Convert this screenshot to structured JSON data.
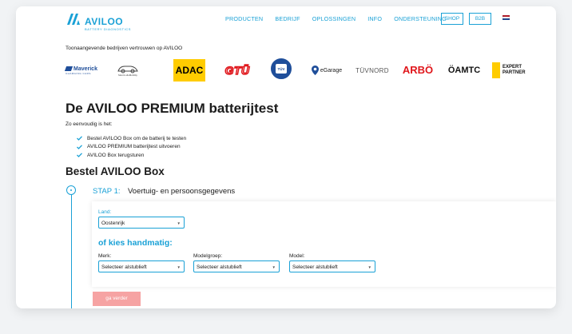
{
  "header": {
    "brand": "AVILOO",
    "brand_sub": "BATTERY DIAGNOSTICS",
    "nav": [
      "PRODUCTEN",
      "BEDRIJF",
      "OPLOSSINGEN",
      "INFO",
      "ONDERSTEUNING"
    ],
    "shop_label": "SHOP",
    "b2b_label": "B2B",
    "flag_colors": [
      "#ae1c28",
      "#ffffff",
      "#21468b"
    ]
  },
  "trusted": {
    "text": "Toonaangevende bedrijven vertrouwen op AVILOO",
    "logos": {
      "maverick": "Maverick",
      "maverick_sub": "CHARGING CARS",
      "mobility_sub": "Merck elloMobility",
      "adac": "ADAC",
      "gtu": "GTÜ",
      "tuv_small": "TÜV",
      "egarage": "eGarage",
      "tuvnord": "TÜVNORD",
      "arbo": "ARBÖ",
      "oamtc": "ÖAMTC",
      "expert": "EXPERT PARTNER"
    }
  },
  "main": {
    "title": "De AVILOO PREMIUM batterijtest",
    "simple": "Zo eenvoudig is het:",
    "checks": [
      "Bestel AVILOO Box om de batterij te testen",
      "AVILOO PREMIUM batterijtest uitvoeren",
      "AVILOO Box terugsturen"
    ],
    "order_title": "Bestel AVILOO Box"
  },
  "step": {
    "label": "STAP 1:",
    "title": "Voertuig- en persoonsgegevens",
    "land_label": "Land:",
    "land_value": "Oostenrijk",
    "manual": "of kies handmatig:",
    "merk_label": "Merk:",
    "merk_value": "Selecteer alstublieft",
    "modelgroep_label": "Modelgroep:",
    "modelgroep_value": "Selecteer alstublieft",
    "model_label": "Model:",
    "model_value": "Selecteer alstublieft",
    "next_label": "ga verder"
  },
  "colors": {
    "accent": "#1aa1d6",
    "button_disabled": "#f6a3a3",
    "check": "#1aa1d6"
  }
}
